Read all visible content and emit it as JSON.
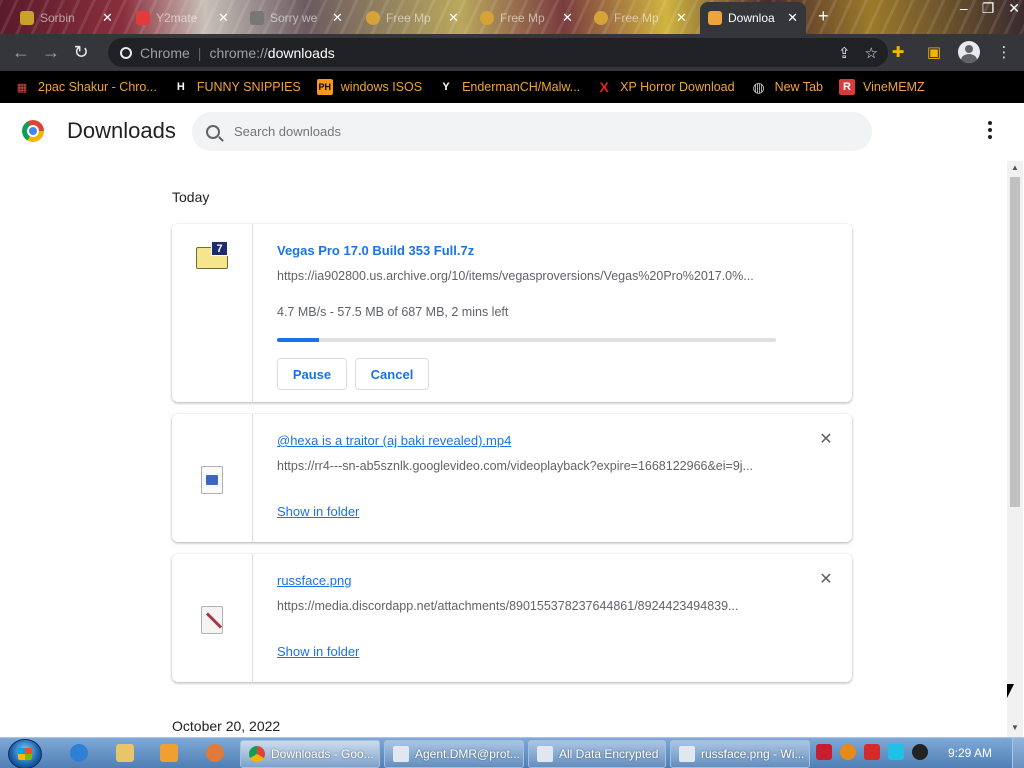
{
  "browser": {
    "tabs": [
      {
        "title": "Sorbin",
        "active": false,
        "icon_color": "#c9a227"
      },
      {
        "title": "Y2mate",
        "active": false,
        "icon_color": "#e23b3b"
      },
      {
        "title": "Sorry we",
        "active": false,
        "icon_color": "#777777"
      },
      {
        "title": "Free Mp",
        "active": false,
        "icon_color": "#d6a23a"
      },
      {
        "title": "Free Mp",
        "active": false,
        "icon_color": "#d6a23a"
      },
      {
        "title": "Free Mp",
        "active": false,
        "icon_color": "#d6a23a"
      },
      {
        "title": "Downloa",
        "active": true,
        "icon_color": "#f1a33b"
      }
    ],
    "new_tab": "+",
    "omnibox": {
      "site_label": "Chrome",
      "separator": "|",
      "url_scheme": "chrome://",
      "url_host": "downloads"
    },
    "bookmarks": [
      {
        "label": "2pac Shakur - Chro...",
        "icon": "film-icon",
        "icon_char": "▦",
        "icon_color": "#d84b4b"
      },
      {
        "label": "FUNNY SNIPPIES",
        "icon": "h-logo-icon",
        "icon_char": "H",
        "icon_color": "#ffffff"
      },
      {
        "label": "windows ISOS",
        "icon": "ph-logo-icon",
        "icon_char": "PH",
        "icon_color": "#f7971d"
      },
      {
        "label": "EndermanCH/Malw...",
        "icon": "yp-logo-icon",
        "icon_char": "Y",
        "icon_color": "#ffffff"
      },
      {
        "label": "XP Horror Download",
        "icon": "x-logo-icon",
        "icon_char": "X",
        "icon_color": "#e02424"
      },
      {
        "label": "New Tab",
        "icon": "globe-icon",
        "icon_char": "◍",
        "icon_color": "#cfcfcf"
      },
      {
        "label": "VineMEMZ",
        "icon": "r-logo-icon",
        "icon_char": "R",
        "icon_color": "#d93a3a"
      }
    ]
  },
  "downloads_page": {
    "title": "Downloads",
    "search_placeholder": "Search downloads",
    "sections": [
      {
        "date_label": "Today"
      },
      {
        "date_label": "October 20, 2022"
      }
    ],
    "items": [
      {
        "file_name": "Vegas Pro 17.0 Build 353 Full.7z",
        "url": "https://ia902800.us.archive.org/10/items/vegasproversions/Vegas%20Pro%2017.0%...",
        "status": "4.7 MB/s - 57.5 MB of 687 MB, 2 mins left",
        "progress_percent": 8.4,
        "pause_label": "Pause",
        "cancel_label": "Cancel",
        "in_progress": true
      },
      {
        "file_name": "@hexa is a traitor (aj baki revealed).mp4",
        "url": "https://rr4---sn-ab5sznlk.googlevideo.com/videoplayback?expire=1668122966&ei=9j...",
        "show_in_folder": "Show in folder",
        "remove": "✕"
      },
      {
        "file_name": "russface.png",
        "url": "https://media.discordapp.net/attachments/890155378237644861/8924423494839...",
        "show_in_folder": "Show in folder",
        "remove": "✕"
      }
    ]
  },
  "taskbar": {
    "tasks": [
      {
        "label": "Downloads - Goo...",
        "active": true,
        "icon_color": "#f1a33b"
      },
      {
        "label": "Agent.DMR@prot...",
        "active": false,
        "icon_color": "#dfe7f0"
      },
      {
        "label": "All Data Encrypted",
        "active": false,
        "icon_color": "#dfe7f0"
      },
      {
        "label": "russface.png - Wi...",
        "active": false,
        "icon_color": "#dfe7f0"
      }
    ],
    "clock": "9:29 AM"
  },
  "colors": {
    "accent": "#1a73e8",
    "bookmark_text": "#f1a33b",
    "toolbar_bg": "#35363a"
  }
}
